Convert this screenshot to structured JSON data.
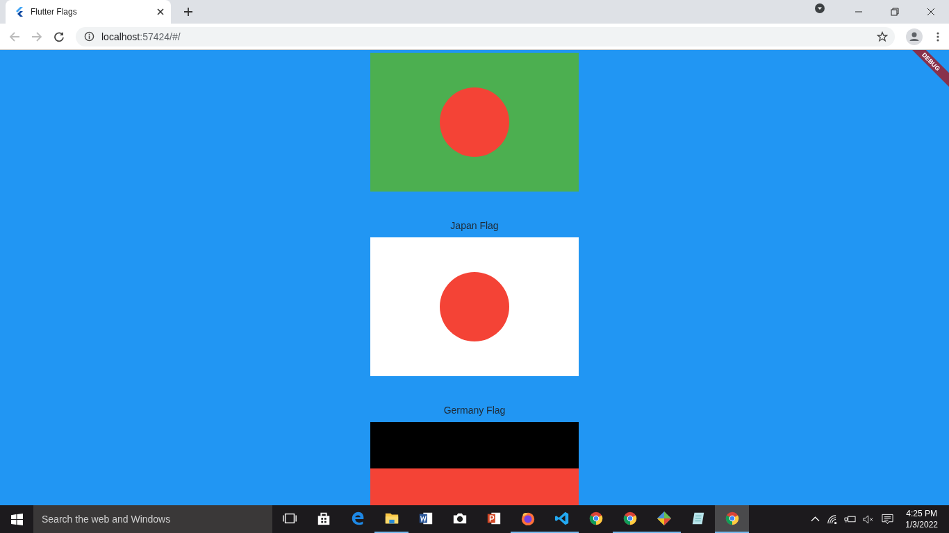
{
  "browser": {
    "tab_title": "Flutter Flags",
    "url_host": "localhost",
    "url_rest": ":57424/#/"
  },
  "debug_banner": "DEBUG",
  "flags": [
    {
      "kind": "green-disc"
    },
    {
      "label": "Japan Flag",
      "kind": "white-disc"
    },
    {
      "label": "Germany Flag",
      "kind": "stripes"
    }
  ],
  "taskbar": {
    "search_placeholder": "Search the web and Windows",
    "apps": [
      {
        "kind": "taskview",
        "open": false,
        "selected": false
      },
      {
        "kind": "store",
        "open": false,
        "selected": false
      },
      {
        "kind": "edge",
        "open": false,
        "selected": false
      },
      {
        "kind": "folder",
        "open": true,
        "selected": false
      },
      {
        "kind": "word",
        "open": false,
        "selected": false
      },
      {
        "kind": "camera",
        "open": false,
        "selected": false
      },
      {
        "kind": "powerpoint",
        "open": false,
        "selected": false
      },
      {
        "kind": "firefox",
        "open": true,
        "selected": false
      },
      {
        "kind": "vscode",
        "open": true,
        "selected": false
      },
      {
        "kind": "chrome",
        "open": false,
        "selected": false
      },
      {
        "kind": "chrome",
        "open": true,
        "selected": false
      },
      {
        "kind": "git",
        "open": true,
        "selected": false
      },
      {
        "kind": "notepad",
        "open": false,
        "selected": false
      },
      {
        "kind": "chrome",
        "open": true,
        "selected": true
      }
    ],
    "time": "4:25 PM",
    "date": "1/3/2022"
  }
}
